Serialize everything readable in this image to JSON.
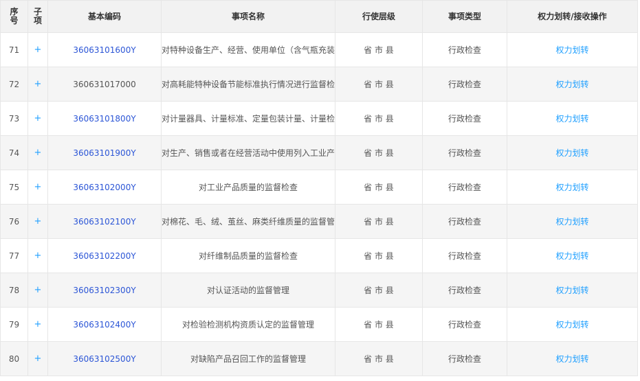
{
  "header": {
    "seq": "序号",
    "sub": "子项",
    "code": "基本编码",
    "name": "事项名称",
    "level": "行使层级",
    "type": "事项类型",
    "op": "权力划转/接收操作"
  },
  "rows": [
    {
      "seq": "71",
      "sub": "+",
      "code": "36063101600Y",
      "code_link": true,
      "name": "对特种设备生产、经营、使用单位（含气瓶充装单位）",
      "level": "省 市 县",
      "type": "行政检查",
      "op": "权力划转"
    },
    {
      "seq": "72",
      "sub": "+",
      "code": "360631017000",
      "code_link": false,
      "name": "对高耗能特种设备节能标准执行情况进行监督检查",
      "level": "省 市 县",
      "type": "行政检查",
      "op": "权力划转"
    },
    {
      "seq": "73",
      "sub": "+",
      "code": "36063101800Y",
      "code_link": true,
      "name": "对计量器具、计量标准、定量包装计量、计量检定",
      "level": "省 市 县",
      "type": "行政检查",
      "op": "权力划转"
    },
    {
      "seq": "74",
      "sub": "+",
      "code": "36063101900Y",
      "code_link": true,
      "name": "对生产、销售或者在经营活动中使用列入工业产品",
      "level": "省 市 县",
      "type": "行政检查",
      "op": "权力划转"
    },
    {
      "seq": "75",
      "sub": "+",
      "code": "36063102000Y",
      "code_link": true,
      "name": "对工业产品质量的监督检查",
      "level": "省 市 县",
      "type": "行政检查",
      "op": "权力划转"
    },
    {
      "seq": "76",
      "sub": "+",
      "code": "36063102100Y",
      "code_link": true,
      "name": "对棉花、毛、绒、茧丝、麻类纤维质量的监督管理",
      "level": "省 市 县",
      "type": "行政检查",
      "op": "权力划转"
    },
    {
      "seq": "77",
      "sub": "+",
      "code": "36063102200Y",
      "code_link": true,
      "name": "对纤维制品质量的监督检查",
      "level": "省 市 县",
      "type": "行政检查",
      "op": "权力划转"
    },
    {
      "seq": "78",
      "sub": "+",
      "code": "36063102300Y",
      "code_link": true,
      "name": "对认证活动的监督管理",
      "level": "省 市 县",
      "type": "行政检查",
      "op": "权力划转"
    },
    {
      "seq": "79",
      "sub": "+",
      "code": "36063102400Y",
      "code_link": true,
      "name": "对检验检测机构资质认定的监督管理",
      "level": "省 市 县",
      "type": "行政检查",
      "op": "权力划转"
    },
    {
      "seq": "80",
      "sub": "+",
      "code": "36063102500Y",
      "code_link": true,
      "name": "对缺陷产品召回工作的监督管理",
      "level": "省 市 县",
      "type": "行政检查",
      "op": "权力划转"
    }
  ]
}
